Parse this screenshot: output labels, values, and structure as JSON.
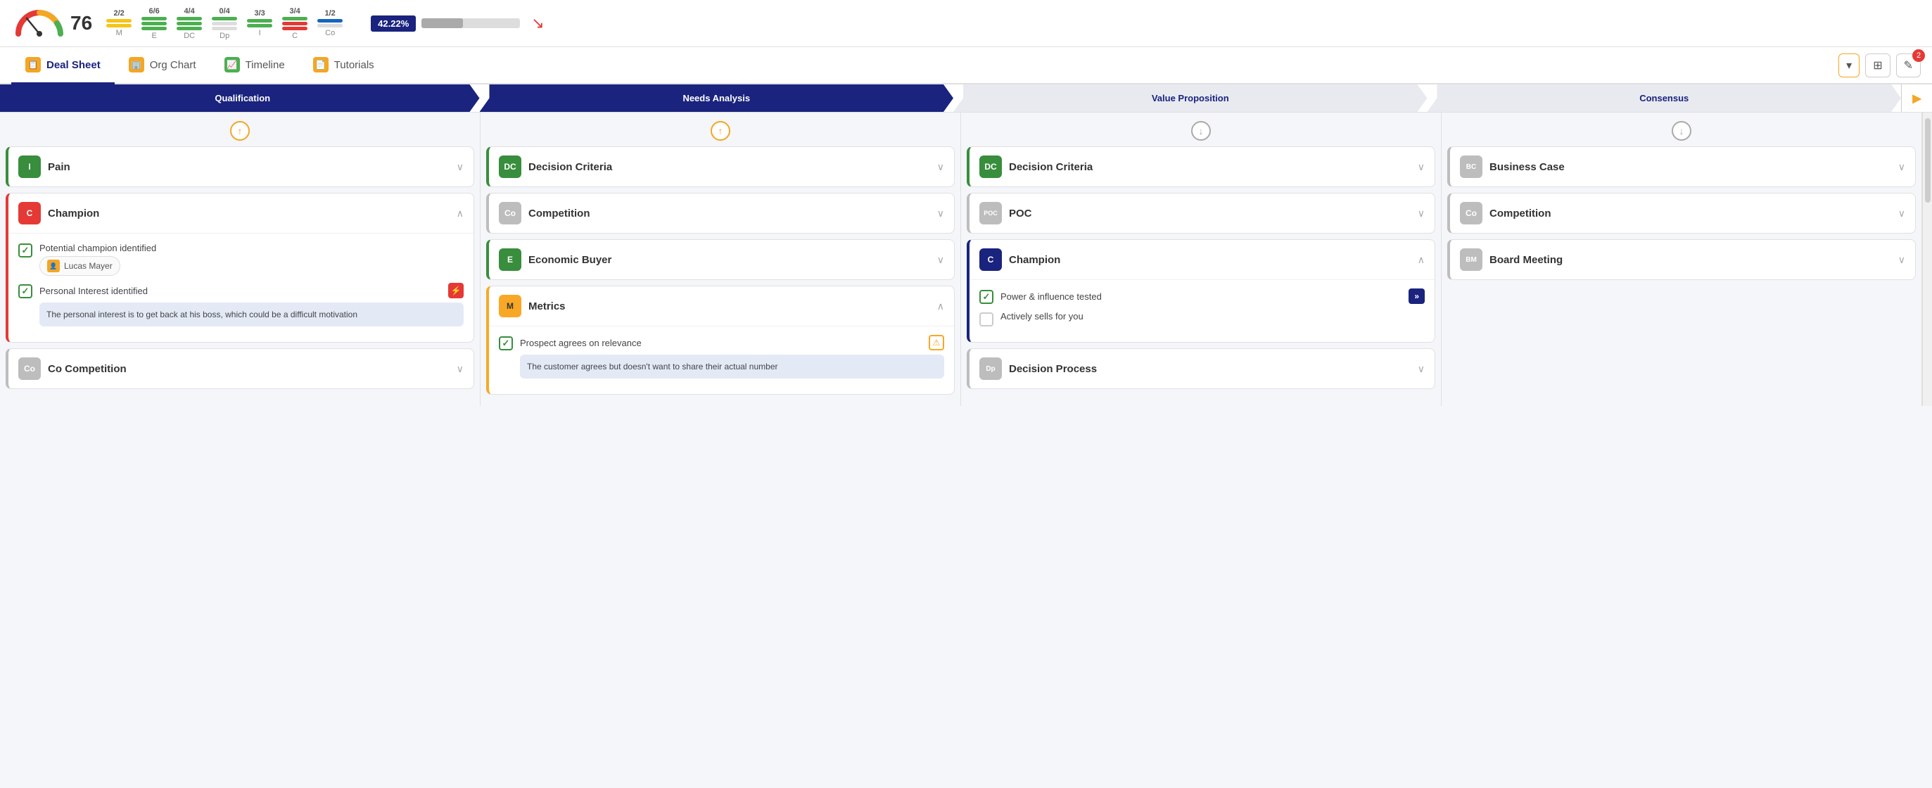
{
  "topBar": {
    "gaugeValue": "76",
    "metrics": [
      {
        "id": "M",
        "fraction": "2/2",
        "color": "yellow"
      },
      {
        "id": "E",
        "fraction": "6/6",
        "color": "green"
      },
      {
        "id": "DC",
        "fraction": "4/4",
        "color": "green"
      },
      {
        "id": "Dp",
        "fraction": "0/4",
        "color": "green"
      },
      {
        "id": "I",
        "fraction": "3/3",
        "color": "green"
      },
      {
        "id": "C",
        "fraction": "3/4",
        "color": "red"
      },
      {
        "id": "Co",
        "fraction": "1/2",
        "color": "blue"
      }
    ],
    "progressLabel": "42.22%",
    "progressPercent": 42
  },
  "nav": {
    "tabs": [
      {
        "id": "deal-sheet",
        "label": "Deal Sheet",
        "icon": "DS",
        "active": true
      },
      {
        "id": "org-chart",
        "label": "Org Chart",
        "icon": "OC",
        "active": false
      },
      {
        "id": "timeline",
        "label": "Timeline",
        "icon": "TL",
        "active": false
      },
      {
        "id": "tutorials",
        "label": "Tutorials",
        "icon": "Tu",
        "active": false
      }
    ],
    "rightButtons": {
      "chevronLabel": "▾",
      "gridLabel": "⊞",
      "editLabel": "✎",
      "badgeCount": "2"
    }
  },
  "pipeline": {
    "stages": [
      {
        "id": "qualification",
        "label": "Qualification",
        "active": true
      },
      {
        "id": "needs-analysis",
        "label": "Needs Analysis",
        "active": true
      },
      {
        "id": "value-proposition",
        "label": "Value Proposition",
        "active": false
      },
      {
        "id": "consensus",
        "label": "Consensus",
        "active": false
      }
    ],
    "arrowLabel": "▶"
  },
  "columns": [
    {
      "id": "qualification",
      "collapseIcon": "↑",
      "cards": [
        {
          "id": "pain",
          "badge": "I",
          "badgeColor": "badge-green",
          "title": "Pain",
          "expanded": false,
          "accentColor": "accent-green"
        },
        {
          "id": "champion",
          "badge": "C",
          "badgeColor": "badge-red",
          "title": "Champion",
          "expanded": true,
          "accentColor": "accent-red",
          "items": [
            {
              "id": "potential-champion",
              "label": "Potential champion identified",
              "checked": true,
              "person": "Lucas Mayer"
            },
            {
              "id": "personal-interest",
              "label": "Personal Interest identified",
              "checked": true,
              "hasFlash": true,
              "note": "The personal interest is to get back at his boss, which could be a difficult motivation"
            }
          ]
        },
        {
          "id": "co-competition-qual",
          "badge": "Co",
          "badgeColor": "badge-gray",
          "title": "Co Competition",
          "expanded": false,
          "accentColor": "accent-gray"
        }
      ]
    },
    {
      "id": "needs-analysis",
      "collapseIcon": "↑",
      "cards": [
        {
          "id": "decision-criteria-na",
          "badge": "DC",
          "badgeColor": "badge-green",
          "title": "Decision Criteria",
          "expanded": false,
          "accentColor": "accent-green"
        },
        {
          "id": "competition-na",
          "badge": "Co",
          "badgeColor": "badge-gray",
          "title": "Competition",
          "expanded": false,
          "accentColor": "accent-gray"
        },
        {
          "id": "economic-buyer",
          "badge": "E",
          "badgeColor": "badge-green",
          "title": "Economic Buyer",
          "expanded": false,
          "accentColor": "accent-green"
        },
        {
          "id": "metrics",
          "badge": "M",
          "badgeColor": "badge-yellow",
          "title": "Metrics",
          "expanded": true,
          "accentColor": "accent-yellow",
          "items": [
            {
              "id": "prospect-agrees",
              "label": "Prospect agrees on relevance",
              "checked": true,
              "hasWarn": true,
              "note": "The customer agrees but doesn't want to share their actual number"
            }
          ]
        }
      ]
    },
    {
      "id": "value-proposition",
      "collapseIcon": "↓",
      "cards": [
        {
          "id": "decision-criteria-vp",
          "badge": "DC",
          "badgeColor": "badge-green",
          "title": "Decision Criteria",
          "expanded": false,
          "accentColor": "accent-green"
        },
        {
          "id": "poc",
          "badge": "POC",
          "badgeColor": "badge-gray",
          "title": "POC",
          "expanded": false,
          "accentColor": "accent-gray"
        },
        {
          "id": "champion-vp",
          "badge": "C",
          "badgeColor": "badge-dark",
          "title": "Champion",
          "expanded": true,
          "accentColor": "accent-dark",
          "items": [
            {
              "id": "power-influence",
              "label": "Power & influence tested",
              "checked": true,
              "hasFwd": true
            },
            {
              "id": "actively-sells",
              "label": "Actively sells for you",
              "checked": false
            }
          ]
        },
        {
          "id": "decision-process",
          "badge": "Dp",
          "badgeColor": "badge-gray",
          "title": "Decision Process",
          "expanded": false,
          "accentColor": "accent-gray"
        }
      ]
    },
    {
      "id": "consensus",
      "collapseIcon": "↓",
      "cards": [
        {
          "id": "business-case",
          "badge": "BC",
          "badgeColor": "badge-gray",
          "title": "Business Case",
          "expanded": false,
          "accentColor": "accent-gray"
        },
        {
          "id": "competition-cons",
          "badge": "Co",
          "badgeColor": "badge-gray",
          "title": "Competition",
          "expanded": false,
          "accentColor": "accent-gray"
        },
        {
          "id": "board-meeting",
          "badge": "BM",
          "badgeColor": "badge-gray",
          "title": "Board Meeting",
          "expanded": false,
          "accentColor": "accent-gray"
        }
      ]
    }
  ]
}
